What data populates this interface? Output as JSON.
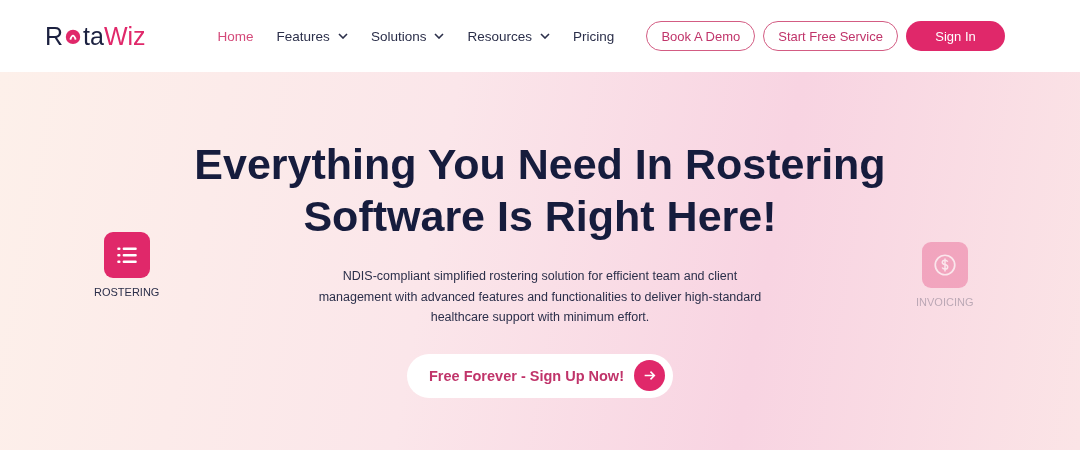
{
  "logo": {
    "start": "R",
    "middle": "ta",
    "accent": "Wiz"
  },
  "nav": [
    {
      "label": "Home",
      "selected": true,
      "dropdown": false
    },
    {
      "label": "Features",
      "selected": false,
      "dropdown": true
    },
    {
      "label": "Solutions",
      "selected": false,
      "dropdown": true
    },
    {
      "label": "Resources",
      "selected": false,
      "dropdown": true
    },
    {
      "label": "Pricing",
      "selected": false,
      "dropdown": false
    }
  ],
  "header_buttons": [
    {
      "label": "Book A Demo",
      "kind": "outline"
    },
    {
      "label": "Start Free Service",
      "kind": "outline"
    },
    {
      "label": "Sign In",
      "kind": "filled"
    }
  ],
  "hero": {
    "headline_lines": [
      "Everything You Need In Rostering",
      "Software Is Right Here!"
    ],
    "description": "NDIS-compliant simplified rostering solution for efficient team and client management with advanced features and functionalities to deliver high-standard healthcare support with minimum effort.",
    "cta": "Free Forever - Sign Up Now!"
  },
  "feature_badges": [
    {
      "label": "ROSTERING",
      "kind": "list",
      "faded": false
    },
    {
      "label": "INVOICING",
      "kind": "dollar",
      "faded": true
    }
  ]
}
